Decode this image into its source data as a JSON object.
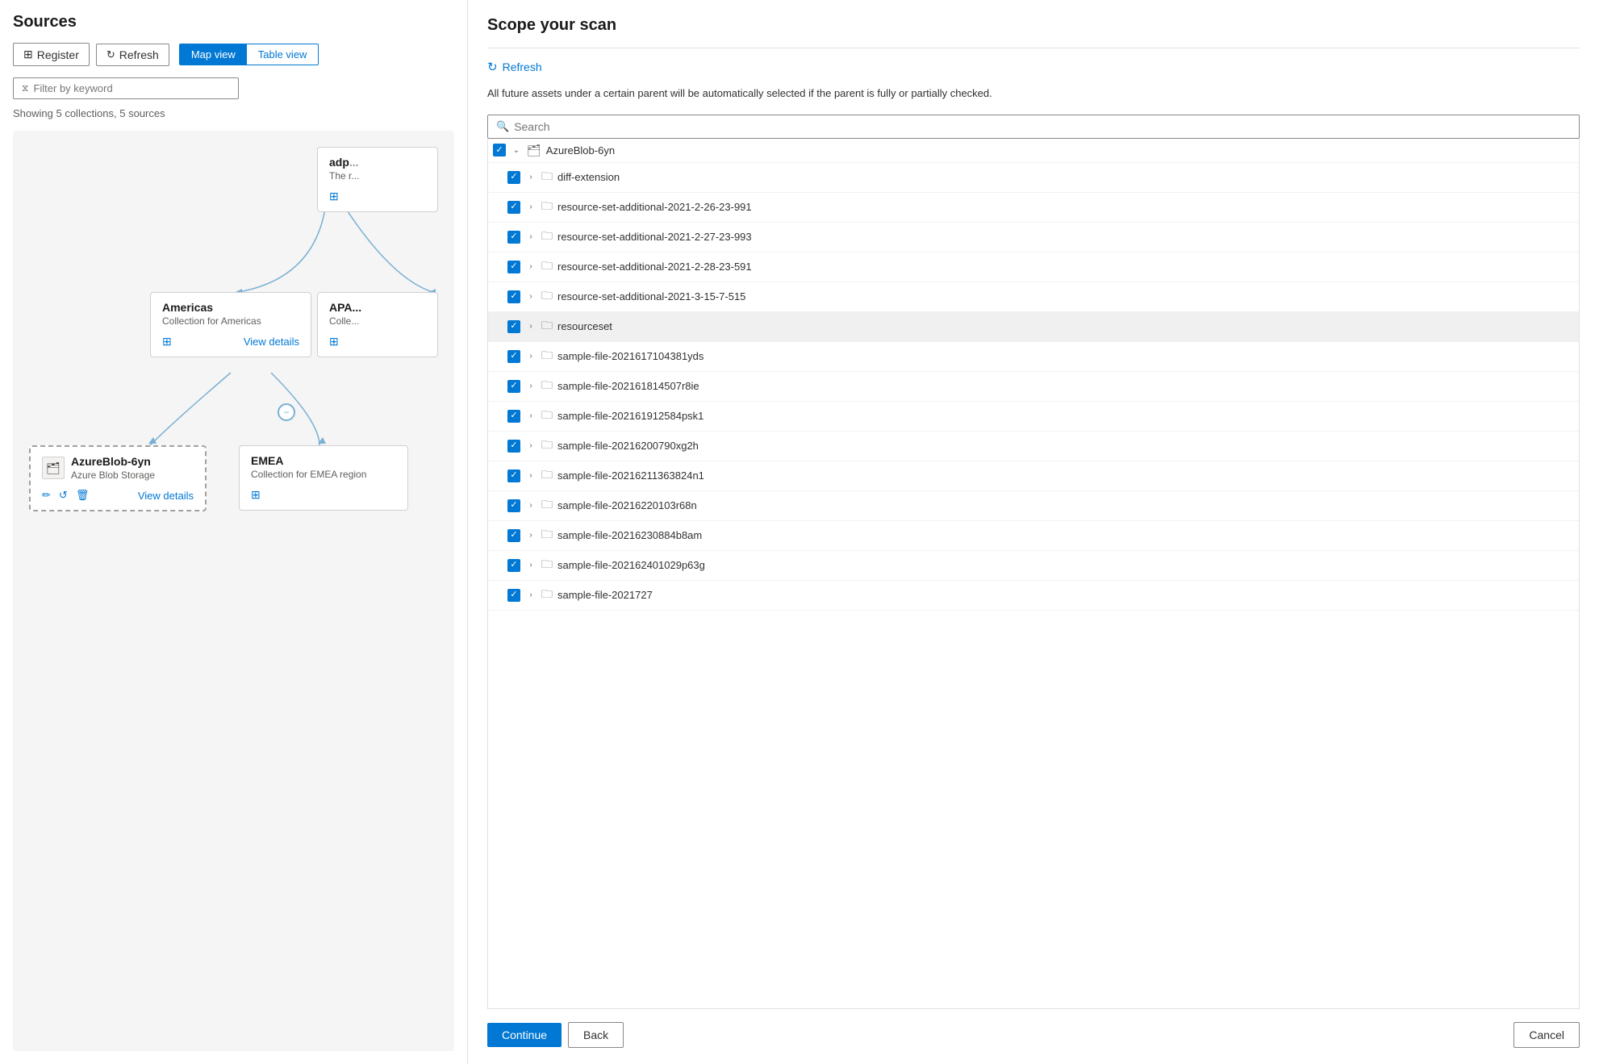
{
  "left": {
    "title": "Sources",
    "toolbar": {
      "register_label": "Register",
      "refresh_label": "Refresh",
      "map_view_label": "Map view",
      "table_view_label": "Table view"
    },
    "filter_placeholder": "Filter by keyword",
    "showing_text": "Showing 5 collections, 5 sources",
    "map": {
      "adp_card": {
        "title": "adp",
        "subtitle": "The r"
      },
      "americas_card": {
        "title": "Americas",
        "subtitle": "Collection for Americas",
        "link": "View details"
      },
      "apac_card": {
        "title": "APA",
        "subtitle": "Colle"
      },
      "azureblob_card": {
        "title": "AzureBlob-6yn",
        "subtitle": "Azure Blob Storage",
        "link": "View details"
      },
      "emea_card": {
        "title": "EMEA",
        "subtitle": "Collection for EMEA region",
        "link": ""
      }
    }
  },
  "right": {
    "title": "Scope your scan",
    "refresh_label": "Refresh",
    "description": "All future assets under a certain parent will be automatically selected if the parent is fully or partially checked.",
    "search_placeholder": "Search",
    "tree": {
      "root": {
        "name": "AzureBlob-6yn",
        "checked": true,
        "expanded": true
      },
      "items": [
        {
          "name": "diff-extension",
          "checked": true,
          "indent": 1
        },
        {
          "name": "resource-set-additional-2021-2-26-23-991",
          "checked": true,
          "indent": 1
        },
        {
          "name": "resource-set-additional-2021-2-27-23-993",
          "checked": true,
          "indent": 1
        },
        {
          "name": "resource-set-additional-2021-2-28-23-591",
          "checked": true,
          "indent": 1
        },
        {
          "name": "resource-set-additional-2021-3-15-7-515",
          "checked": true,
          "indent": 1
        },
        {
          "name": "resourceset",
          "checked": true,
          "indent": 1,
          "highlighted": true
        },
        {
          "name": "sample-file-2021617104381yds",
          "checked": true,
          "indent": 1
        },
        {
          "name": "sample-file-202161814507r8ie",
          "checked": true,
          "indent": 1
        },
        {
          "name": "sample-file-202161912584psk1",
          "checked": true,
          "indent": 1
        },
        {
          "name": "sample-file-20216200790xg2h",
          "checked": true,
          "indent": 1
        },
        {
          "name": "sample-file-20216211363824n1",
          "checked": true,
          "indent": 1
        },
        {
          "name": "sample-file-20216220103r68n",
          "checked": true,
          "indent": 1
        },
        {
          "name": "sample-file-20216230884b8am",
          "checked": true,
          "indent": 1
        },
        {
          "name": "sample-file-202162401029p63g",
          "checked": true,
          "indent": 1
        },
        {
          "name": "sample-file-2021727",
          "checked": true,
          "indent": 1
        }
      ]
    },
    "buttons": {
      "continue_label": "Continue",
      "back_label": "Back",
      "cancel_label": "Cancel"
    }
  }
}
